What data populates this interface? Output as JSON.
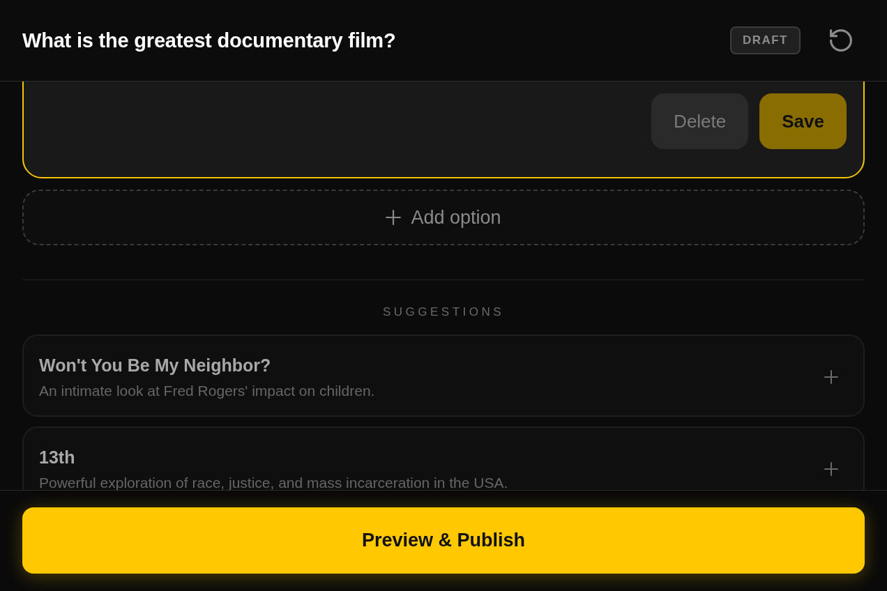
{
  "header": {
    "title": "What is the greatest documentary film?",
    "badge": "DRAFT"
  },
  "editor": {
    "buttons": [
      {
        "label": "Delete",
        "kind": "secondary",
        "disabled": false
      },
      {
        "label": "Save",
        "kind": "primary",
        "disabled": true
      }
    ]
  },
  "add_option": {
    "label": "Add option"
  },
  "suggestions": {
    "heading": "SUGGESTIONS",
    "items": [
      {
        "title": "Won't You Be My Neighbor?",
        "description": "An intimate look at Fred Rogers' impact on children."
      },
      {
        "title": "13th",
        "description": "Powerful exploration of race, justice, and mass incarceration in the USA."
      }
    ]
  },
  "footer": {
    "button": "Preview & Publish"
  }
}
